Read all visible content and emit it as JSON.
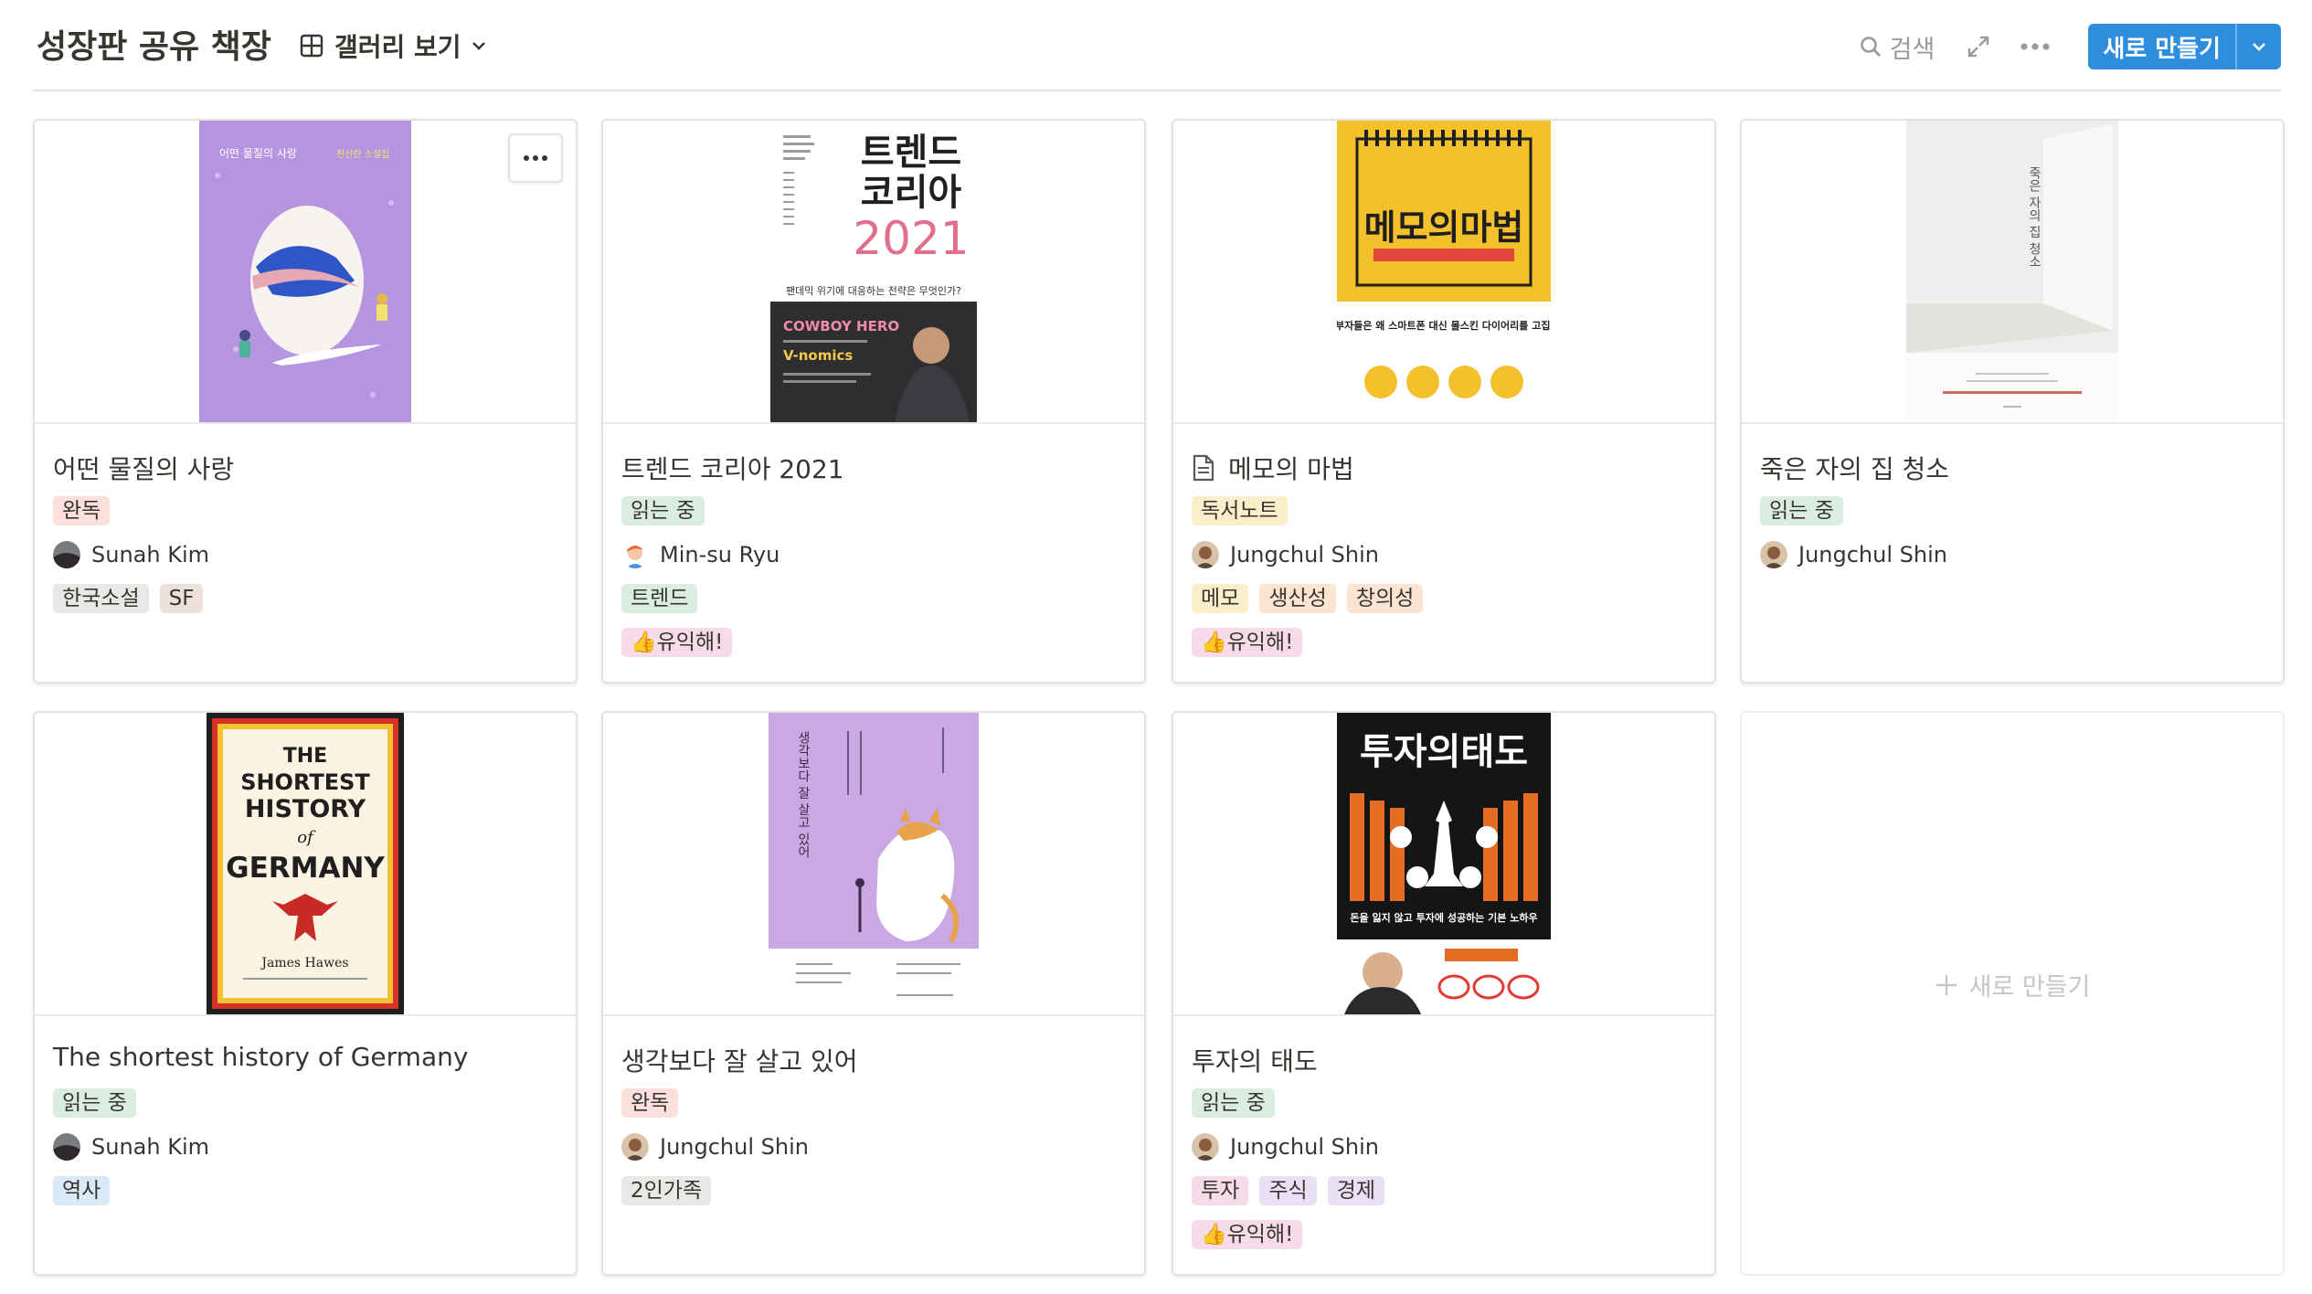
{
  "header": {
    "title": "성장판 공유 책장",
    "view_label": "갤러리 보기",
    "search_label": "검색",
    "new_button_label": "새로 만들기"
  },
  "colors": {
    "accent": "#2f8dde",
    "tag_red": "#fde0dc",
    "tag_green": "#dbede1",
    "tag_gray": "#e9e8e6",
    "tag_brown": "#eee0da",
    "tag_pink": "#f7dbe9",
    "tag_yellow": "#fbeecb",
    "tag_orange": "#fbe4d2",
    "tag_blue": "#d9e9f7",
    "tag_purple": "#e9e0f5"
  },
  "cards": [
    {
      "title": "어떤 물질의 사랑",
      "status": "완독",
      "owner": "Sunah Kim",
      "tags": [
        "한국소설",
        "SF"
      ],
      "cover_text": [
        "어떤 물질의 사랑",
        "천선란 소설집"
      ]
    },
    {
      "title": "트렌드 코리아 2021",
      "status": "읽는 중",
      "owner": "Min-su Ryu",
      "tags": [
        "트렌드"
      ],
      "extra_tag": "👍유익해!",
      "cover_text": [
        "트렌드",
        "코리아",
        "2021",
        "팬데믹 위기에 대응하는 전략은 무엇인가?",
        "COWBOY HERO",
        "V-nomics"
      ]
    },
    {
      "title": "메모의 마법",
      "status": "독서노트",
      "owner": "Jungchul Shin",
      "tags": [
        "메모",
        "생산성",
        "창의성"
      ],
      "extra_tag": "👍유익해!",
      "cover_text": [
        "메모의마법",
        "젊은 부자들은 왜 스마트폰 대신 몰스킨 다이어리를 고집할까?"
      ]
    },
    {
      "title": "죽은 자의 집 청소",
      "status": "읽는 중",
      "owner": "Jungchul Shin",
      "tags": [],
      "cover_text": [
        "죽은 자의 집 청소"
      ]
    },
    {
      "title": "The shortest history of Germany",
      "status": "읽는 중",
      "owner": "Sunah Kim",
      "tags": [
        "역사"
      ],
      "cover_text": [
        "THE",
        "SHORTEST",
        "HISTORY",
        "of",
        "GERMANY",
        "James Hawes"
      ]
    },
    {
      "title": "생각보다 잘 살고 있어",
      "status": "완독",
      "owner": "Jungchul Shin",
      "tags": [
        "2인가족"
      ],
      "cover_text": [
        "생각보다 잘 살고 있어"
      ]
    },
    {
      "title": "투자의 태도",
      "status": "읽는 중",
      "owner": "Jungchul Shin",
      "tags": [
        "투자",
        "주식",
        "경제"
      ],
      "extra_tag": "👍유익해!",
      "cover_text": [
        "투자의태도",
        "돈을 잃지 않고 투자에 성공하는 기본 노하우"
      ]
    }
  ],
  "new_card_label": "새로 만들기"
}
